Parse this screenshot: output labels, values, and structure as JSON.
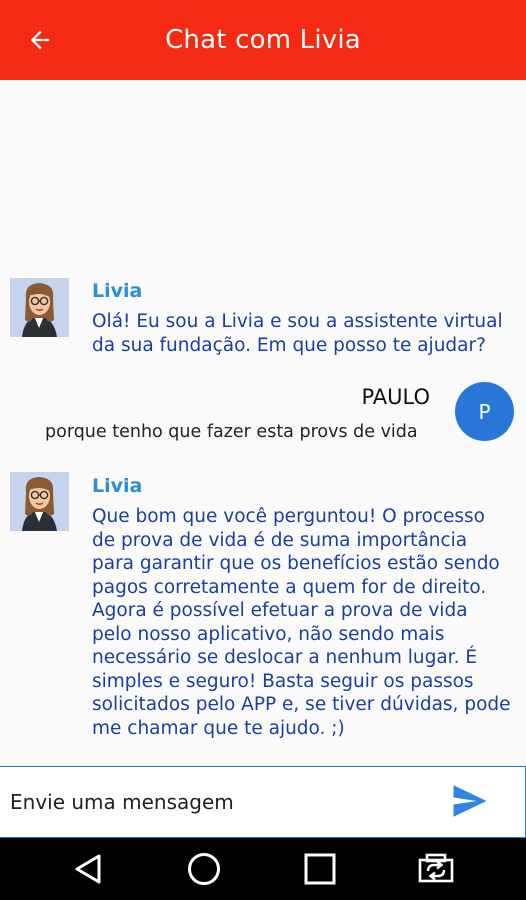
{
  "appbar": {
    "title": "Chat com Livia",
    "back_icon": "arrow-back-icon",
    "background": "#f42a12"
  },
  "messages": [
    {
      "sender": "Livia",
      "text": "Olá! Eu sou a Livia e sou a assistente virtual da sua fundação. Em que posso te ajudar?"
    },
    {
      "sender": "PAULO",
      "avatar_letter": "P",
      "text": "porque tenho que fazer esta provs de vida"
    },
    {
      "sender": "Livia",
      "text": "Que bom que você perguntou! O processo de prova de vida é de suma importância para garantir que os benefícios estão sendo pagos corretamente a quem for de direito. Agora é possível efetuar a prova de vida pelo nosso aplicativo, não sendo mais necessário se deslocar a nenhum lugar. É simples e seguro! Basta seguir os passos solicitados pelo APP e, se tiver dúvidas, pode me chamar que te ajudo. ;)"
    }
  ],
  "composer": {
    "placeholder": "Envie uma mensagem",
    "send_icon": "send-icon",
    "accent": "#2a78c2"
  },
  "navbar": {
    "icons": [
      "back-triangle-icon",
      "home-circle-icon",
      "recents-square-icon",
      "screen-rotate-icon"
    ]
  }
}
